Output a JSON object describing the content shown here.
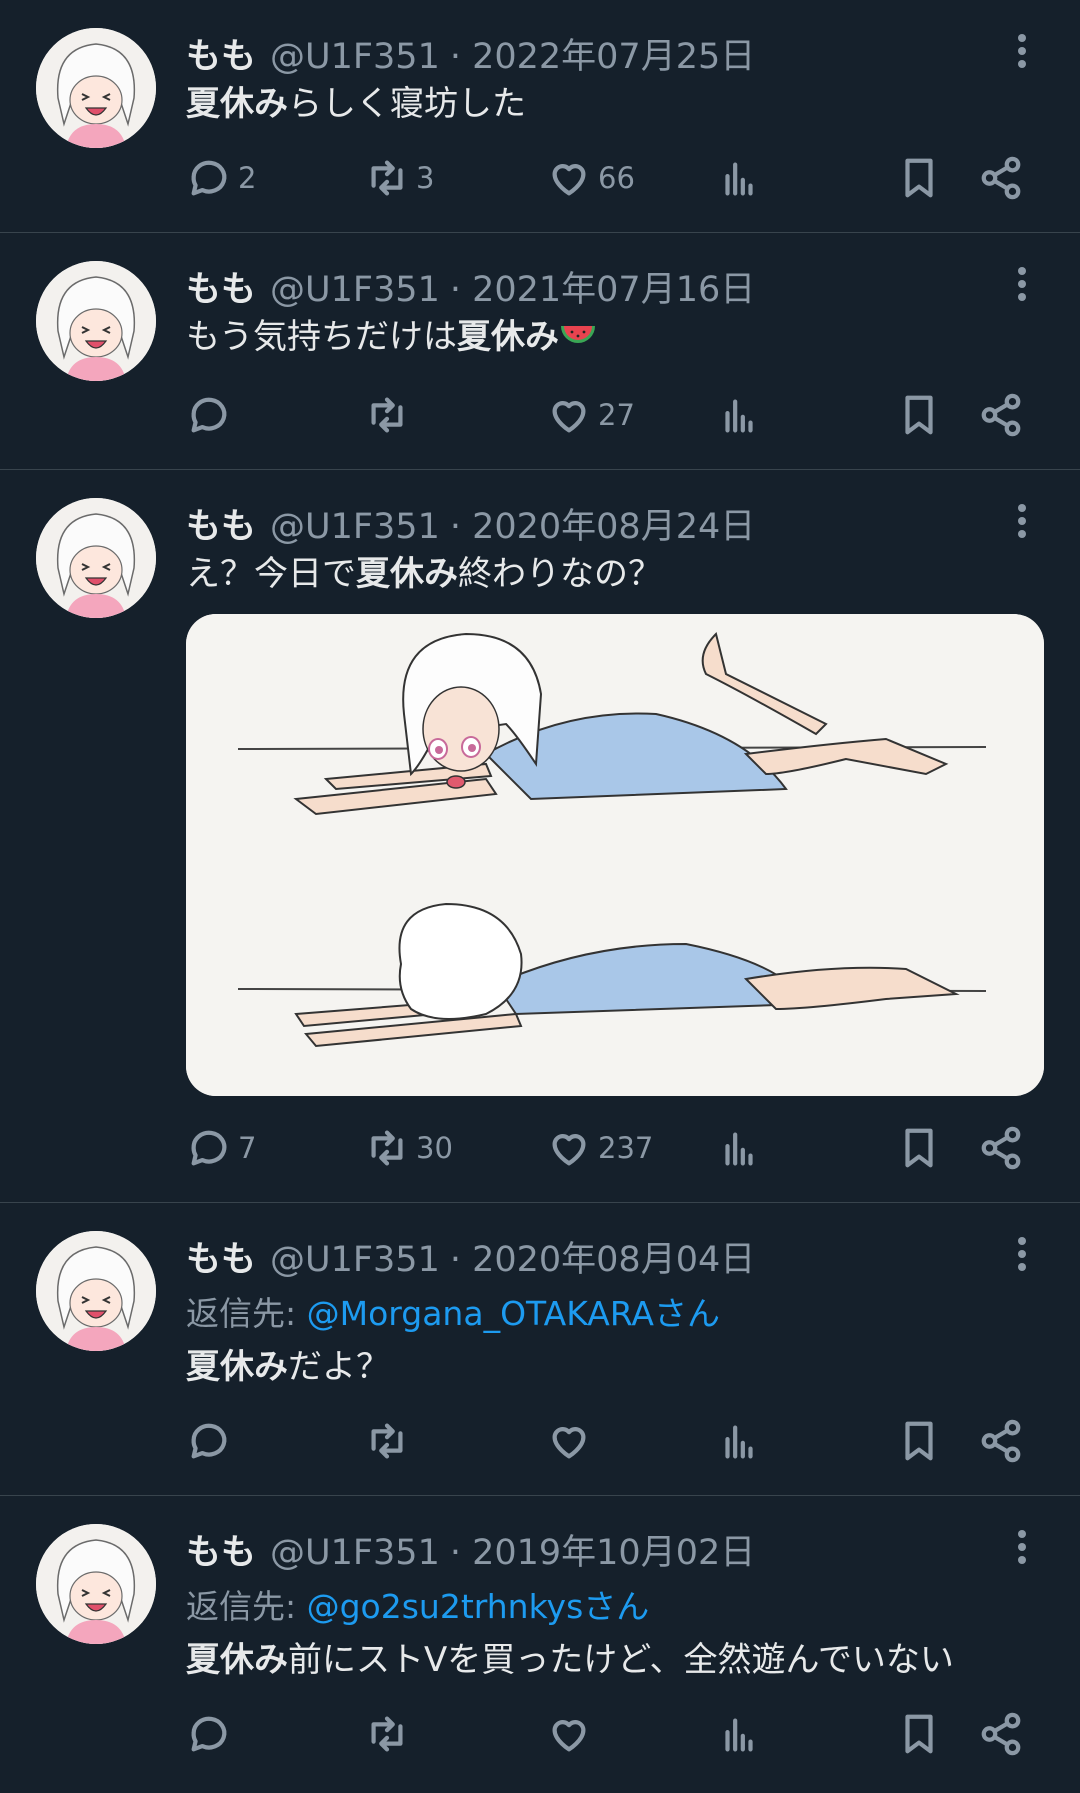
{
  "tweets": [
    {
      "name": "もも",
      "handle": "@U1F351",
      "date": "· 2022年07月25日",
      "reply_to_prefix": "",
      "reply_to_handle": "",
      "text_bold": "夏休み",
      "text_pre": "",
      "text_post": "らしく寝坊した",
      "has_melon": false,
      "has_image": false,
      "replies": "2",
      "retweets": "3",
      "likes": "66"
    },
    {
      "name": "もも",
      "handle": "@U1F351",
      "date": "· 2021年07月16日",
      "reply_to_prefix": "",
      "reply_to_handle": "",
      "text_pre": "もう気持ちだけは",
      "text_bold": "夏休み",
      "text_post": "",
      "has_melon": true,
      "has_image": false,
      "replies": "",
      "retweets": "",
      "likes": "27"
    },
    {
      "name": "もも",
      "handle": "@U1F351",
      "date": "· 2020年08月24日",
      "reply_to_prefix": "",
      "reply_to_handle": "",
      "text_pre": "え？今日で",
      "text_bold": "夏休み",
      "text_post": "終わりなの？",
      "has_melon": false,
      "has_image": true,
      "replies": "7",
      "retweets": "30",
      "likes": "237"
    },
    {
      "name": "もも",
      "handle": "@U1F351",
      "date": "· 2020年08月04日",
      "reply_to_prefix": "返信先: ",
      "reply_to_handle": "@Morgana_OTAKARAさん",
      "text_pre": "",
      "text_bold": "夏休み",
      "text_post": "だよ？",
      "has_melon": false,
      "has_image": false,
      "replies": "",
      "retweets": "",
      "likes": ""
    },
    {
      "name": "もも",
      "handle": "@U1F351",
      "date": "· 2019年10月02日",
      "reply_to_prefix": "返信先: ",
      "reply_to_handle": "@go2su2trhnkysさん",
      "text_pre": "",
      "text_bold": "夏休み",
      "text_post": "前にストVを買ったけど、全然遊んでいない",
      "has_melon": false,
      "has_image": false,
      "replies": "",
      "retweets": "",
      "likes": ""
    }
  ],
  "colors": {
    "background": "#15202b",
    "text": "#e7e9ea",
    "muted": "#8b98a5",
    "link": "#1d9bf0",
    "divider": "#38444d"
  },
  "icons": [
    "reply-icon",
    "retweet-icon",
    "like-icon",
    "views-icon",
    "bookmark-icon",
    "share-icon",
    "more-icon",
    "watermelon-icon"
  ]
}
